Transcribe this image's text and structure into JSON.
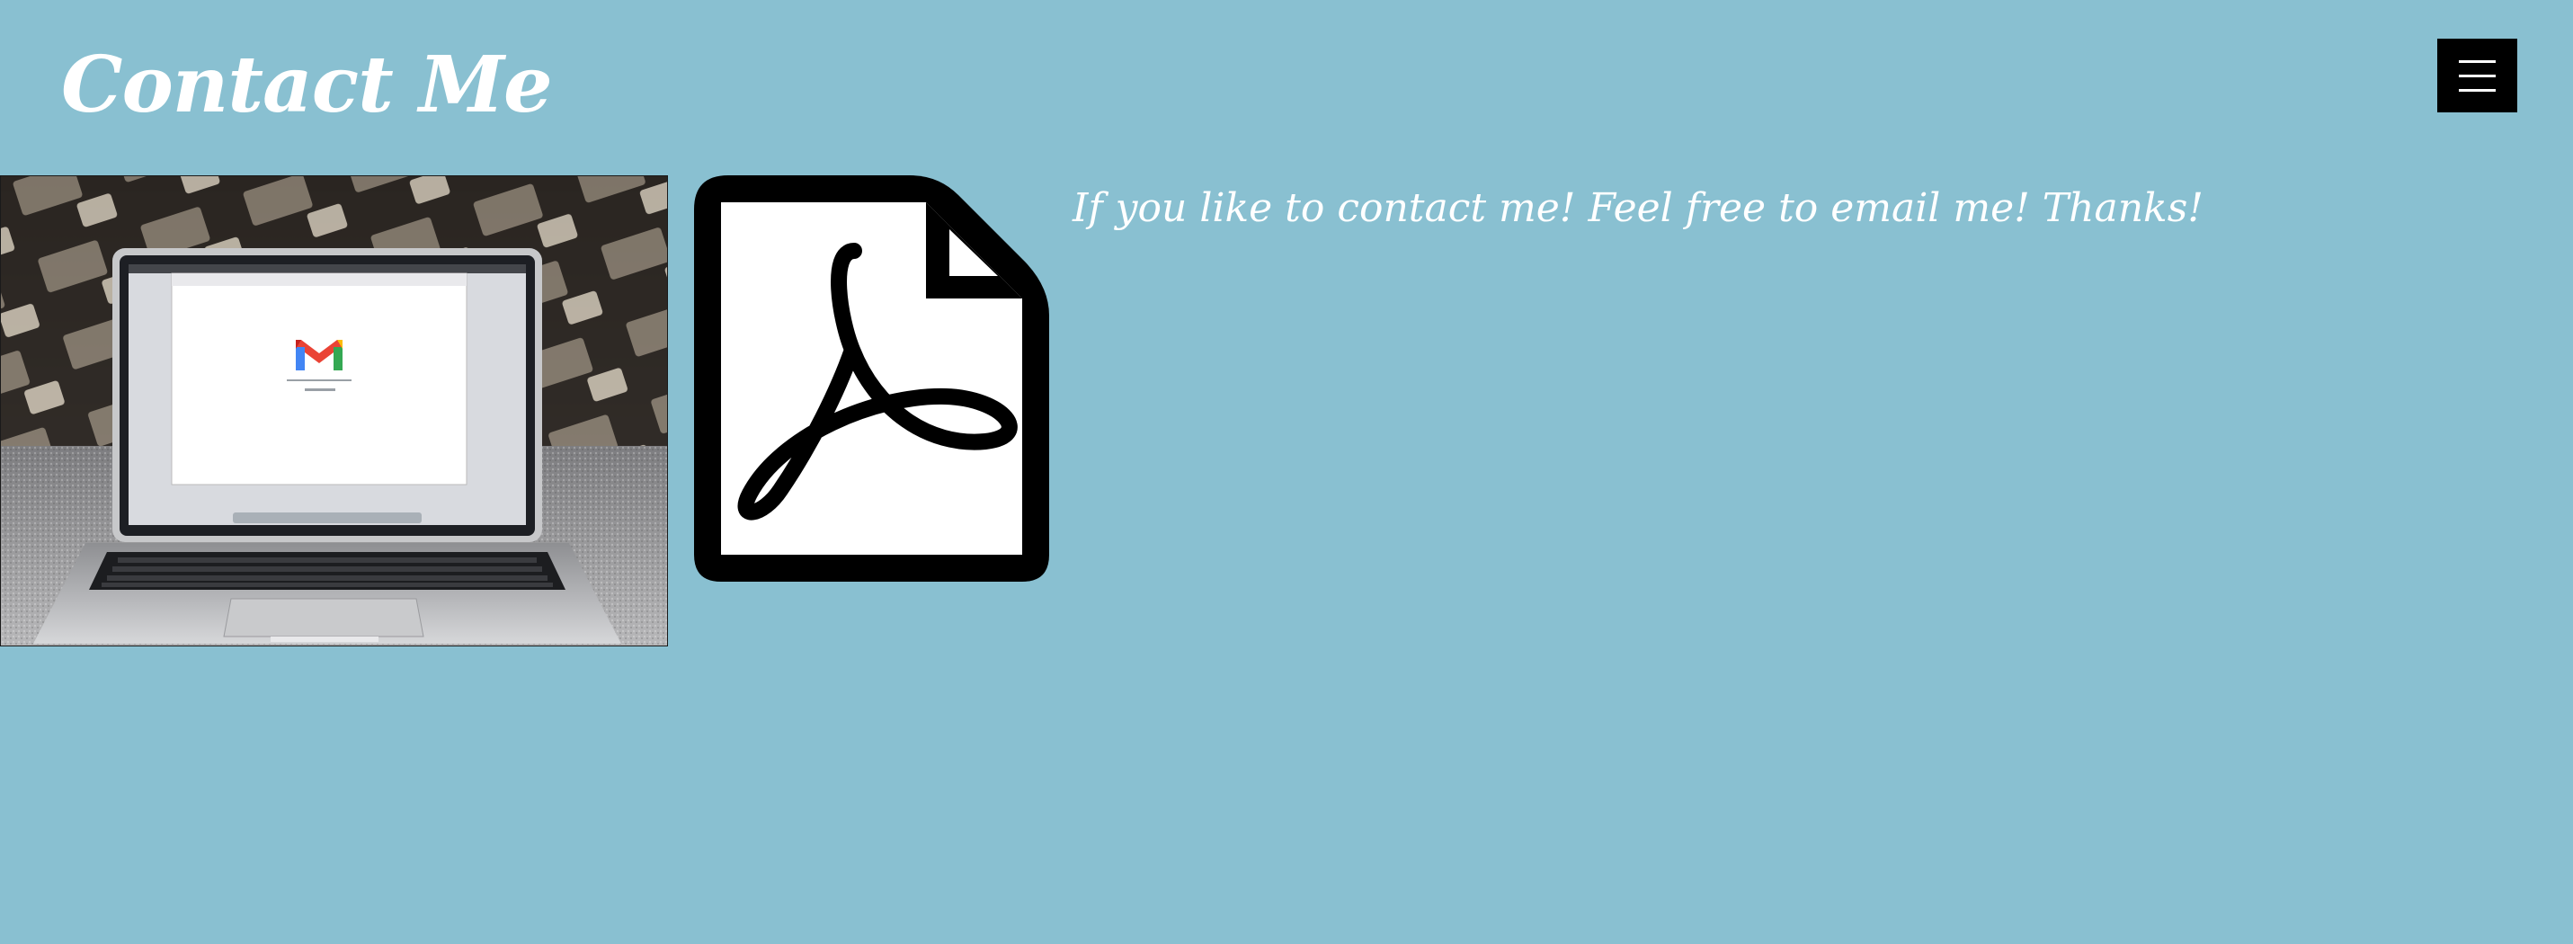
{
  "header": {
    "title": "Contact Me",
    "menu_icon": "hamburger-menu-icon"
  },
  "main": {
    "photo_description_icon": "laptop-gmail-photo",
    "screen_logo_text": "M",
    "document_icon": "pdf-file-icon",
    "message": "If you like to contact me! Feel free to email me! Thanks!"
  },
  "colors": {
    "page_background": "#89c0d1",
    "text": "#ffffff",
    "menu_button": "#000000",
    "icon_stroke": "#000000"
  }
}
